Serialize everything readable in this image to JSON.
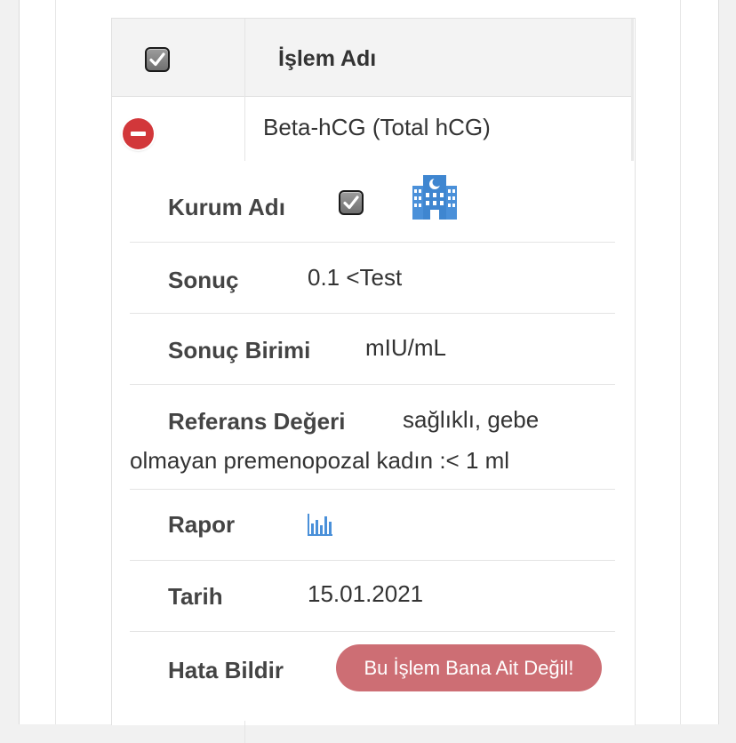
{
  "table": {
    "header": {
      "title": "İşlem Adı",
      "select_all_checked": true
    },
    "row": {
      "procedure_name": "Beta-hCG (Total hCG)",
      "expanded": true,
      "details": [
        {
          "key": "kurum",
          "label": "Kurum Adı"
        },
        {
          "key": "sonuc",
          "label": "Sonuç",
          "value": "0.1 <Test"
        },
        {
          "key": "birim",
          "label": "Sonuç Birimi",
          "value": "mIU/mL"
        },
        {
          "key": "referans",
          "label": "Referans Değeri",
          "value_line1": "sağlıklı, gebe",
          "value_line2": "olmayan premenopozal kadın :< 1 ml"
        },
        {
          "key": "rapor",
          "label": "Rapor"
        },
        {
          "key": "tarih",
          "label": "Tarih",
          "value": "15.01.2021"
        },
        {
          "key": "hata",
          "label": "Hata Bildir",
          "button_label": "Bu İşlem Bana Ait Değil!"
        }
      ]
    }
  },
  "icons": {
    "checkbox": "checkbox-checked-icon",
    "hospital": "hospital-icon",
    "report": "bar-chart-icon",
    "collapse": "minus-circle-icon"
  },
  "colors": {
    "collapse_button": "#d2373a",
    "report_button": "#cd6e74",
    "icon_blue": "#4a90d9"
  }
}
